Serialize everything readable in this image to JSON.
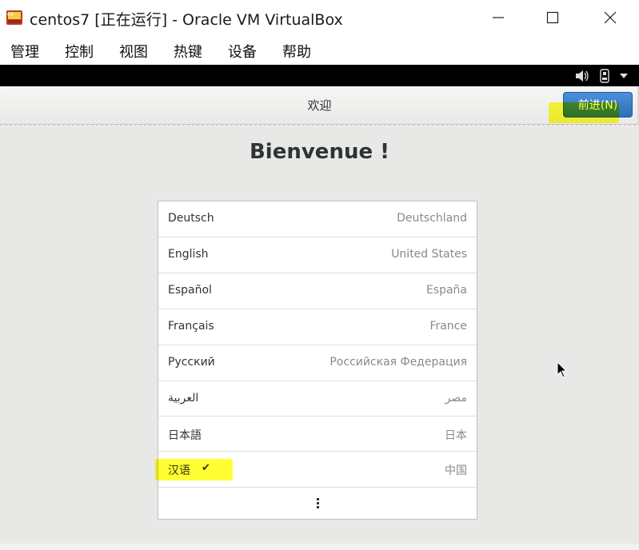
{
  "window": {
    "title": "centos7 [正在运行] - Oracle VM VirtualBox",
    "app_icon": "virtualbox-icon",
    "controls": [
      "minimize-icon",
      "maximize-icon",
      "close-icon"
    ]
  },
  "menubar": {
    "items": [
      "管理",
      "控制",
      "视图",
      "热键",
      "设备",
      "帮助"
    ]
  },
  "vm_status": {
    "icons": [
      "audio-icon",
      "usb-icon",
      "dropdown-arrow-icon"
    ]
  },
  "installer": {
    "header_title": "欢迎",
    "next_button_label": "前进(N)",
    "heading": "Bienvenue !",
    "languages": [
      {
        "name": "Deutsch",
        "region": "Deutschland",
        "selected": false
      },
      {
        "name": "English",
        "region": "United States",
        "selected": false
      },
      {
        "name": "Español",
        "region": "España",
        "selected": false
      },
      {
        "name": "Français",
        "region": "France",
        "selected": false
      },
      {
        "name": "Русский",
        "region": "Российская Федерация",
        "selected": false
      },
      {
        "name": "العربية",
        "region": "مصر",
        "selected": false
      },
      {
        "name": "日本語",
        "region": "日本",
        "selected": false
      },
      {
        "name": "汉语",
        "region": "中国",
        "selected": true
      }
    ],
    "check_mark": "✔"
  },
  "colors": {
    "highlight": "#ffff00",
    "button_blue": "#3a7fcc",
    "vm_background": "#e8e8e7"
  }
}
